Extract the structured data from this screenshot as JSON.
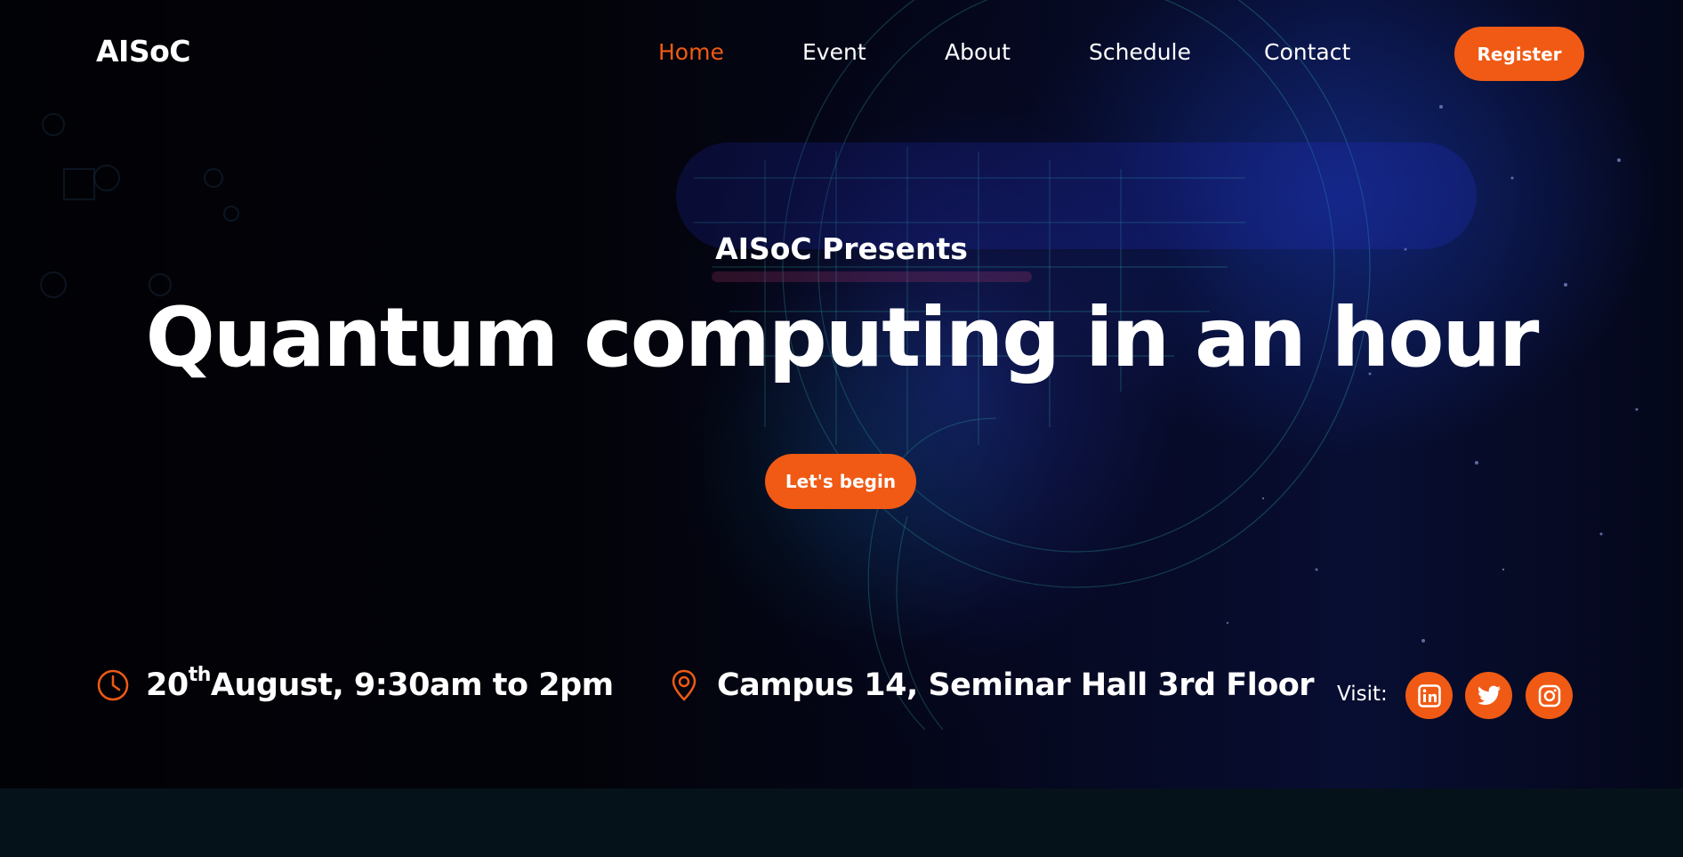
{
  "nav": {
    "logo": "AISoC",
    "links": [
      {
        "label": "Home",
        "active": true
      },
      {
        "label": "Event",
        "active": false
      },
      {
        "label": "About",
        "active": false
      },
      {
        "label": "Schedule",
        "active": false
      },
      {
        "label": "Contact",
        "active": false
      }
    ],
    "register_label": "Register"
  },
  "hero": {
    "presents": "AISoC Presents",
    "headline": "Quantum computing in an hour",
    "cta_label": "Let's begin"
  },
  "info": {
    "date_day": "20",
    "date_suffix": "th",
    "date_rest": "August, 9:30am to 2pm",
    "venue": "Campus 14, Seminar Hall 3rd Floor",
    "visit_label": "Visit:"
  },
  "social": [
    "linkedin-icon",
    "twitter-icon",
    "instagram-icon"
  ],
  "colors": {
    "accent": "#f05a14",
    "text": "#ffffff",
    "background": "#050610"
  }
}
